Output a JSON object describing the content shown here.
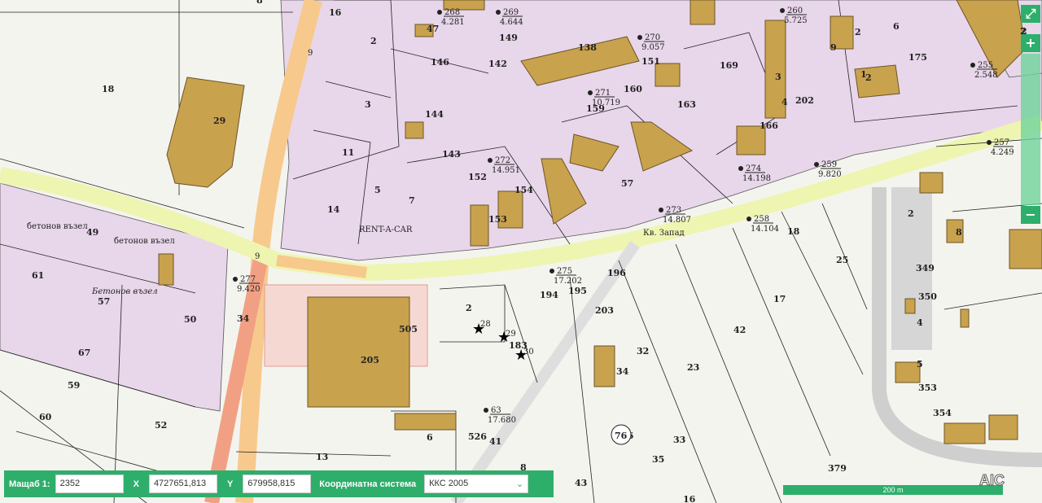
{
  "map": {
    "parcels": [
      "8",
      "18",
      "2",
      "16",
      "3",
      "11",
      "5",
      "14",
      "7",
      "29",
      "146",
      "144",
      "149",
      "142",
      "47",
      "138",
      "151",
      "169",
      "175",
      "2",
      "160",
      "163",
      "159",
      "202",
      "166",
      "143",
      "152",
      "154",
      "153",
      "57",
      "50",
      "49",
      "61",
      "57",
      "34",
      "67",
      "59",
      "60",
      "52",
      "13",
      "6",
      "41",
      "8",
      "43",
      "16",
      "35",
      "33",
      "32",
      "34",
      "23",
      "42",
      "17",
      "25",
      "18",
      "194",
      "195",
      "196",
      "203",
      "2",
      "183",
      "205",
      "505",
      "526",
      "76",
      "2",
      "349",
      "350",
      "4",
      "5",
      "353",
      "354",
      "379",
      "8",
      "2",
      "3",
      "4",
      "2",
      "2",
      "1",
      "9",
      "6"
    ],
    "benchmarks": [
      {
        "id": "268",
        "elev": "4.281"
      },
      {
        "id": "269",
        "elev": "4.644"
      },
      {
        "id": "270",
        "elev": "9.057"
      },
      {
        "id": "271",
        "elev": "10.719"
      },
      {
        "id": "260",
        "elev": "5.725"
      },
      {
        "id": "255",
        "elev": "2.548"
      },
      {
        "id": "257",
        "elev": "4.249"
      },
      {
        "id": "272",
        "elev": "14.951"
      },
      {
        "id": "274",
        "elev": "14.198"
      },
      {
        "id": "259",
        "elev": "9.820"
      },
      {
        "id": "273",
        "elev": "14.807"
      },
      {
        "id": "258",
        "elev": "14.104"
      },
      {
        "id": "277",
        "elev": "9.420"
      },
      {
        "id": "275",
        "elev": "17.202"
      },
      {
        "id": "63",
        "elev": "17.680"
      }
    ],
    "street_labels": [
      "бетонов възел",
      "бетонов възел",
      "Бетонов възел"
    ],
    "poi_labels": [
      "RENT-A-CAR",
      "Кв. Запад"
    ],
    "stars": [
      "28",
      "29",
      "30"
    ],
    "road_numbers": [
      "9",
      "9"
    ],
    "circle_label": "76",
    "colors": {
      "zone": "#e8d6ea",
      "building": "#c9a24e",
      "road_green": "#eef5b0",
      "road_orange": "#f7c98c",
      "road_red": "#f2a084",
      "accent": "#2eae6b"
    }
  },
  "zoom": {
    "in_label": "+",
    "out_label": "−",
    "fullscreen_icon": "expand-icon"
  },
  "bar": {
    "scale_label": "Мащаб  1:",
    "scale_value": "2352",
    "x_label": "X",
    "x_value": "4727651,813",
    "y_label": "Y",
    "y_value": "679958,815",
    "crs_label": "Координатна система",
    "crs_value": "ККС 2005"
  },
  "scale_text": "200 m",
  "logo_text": "AIC"
}
